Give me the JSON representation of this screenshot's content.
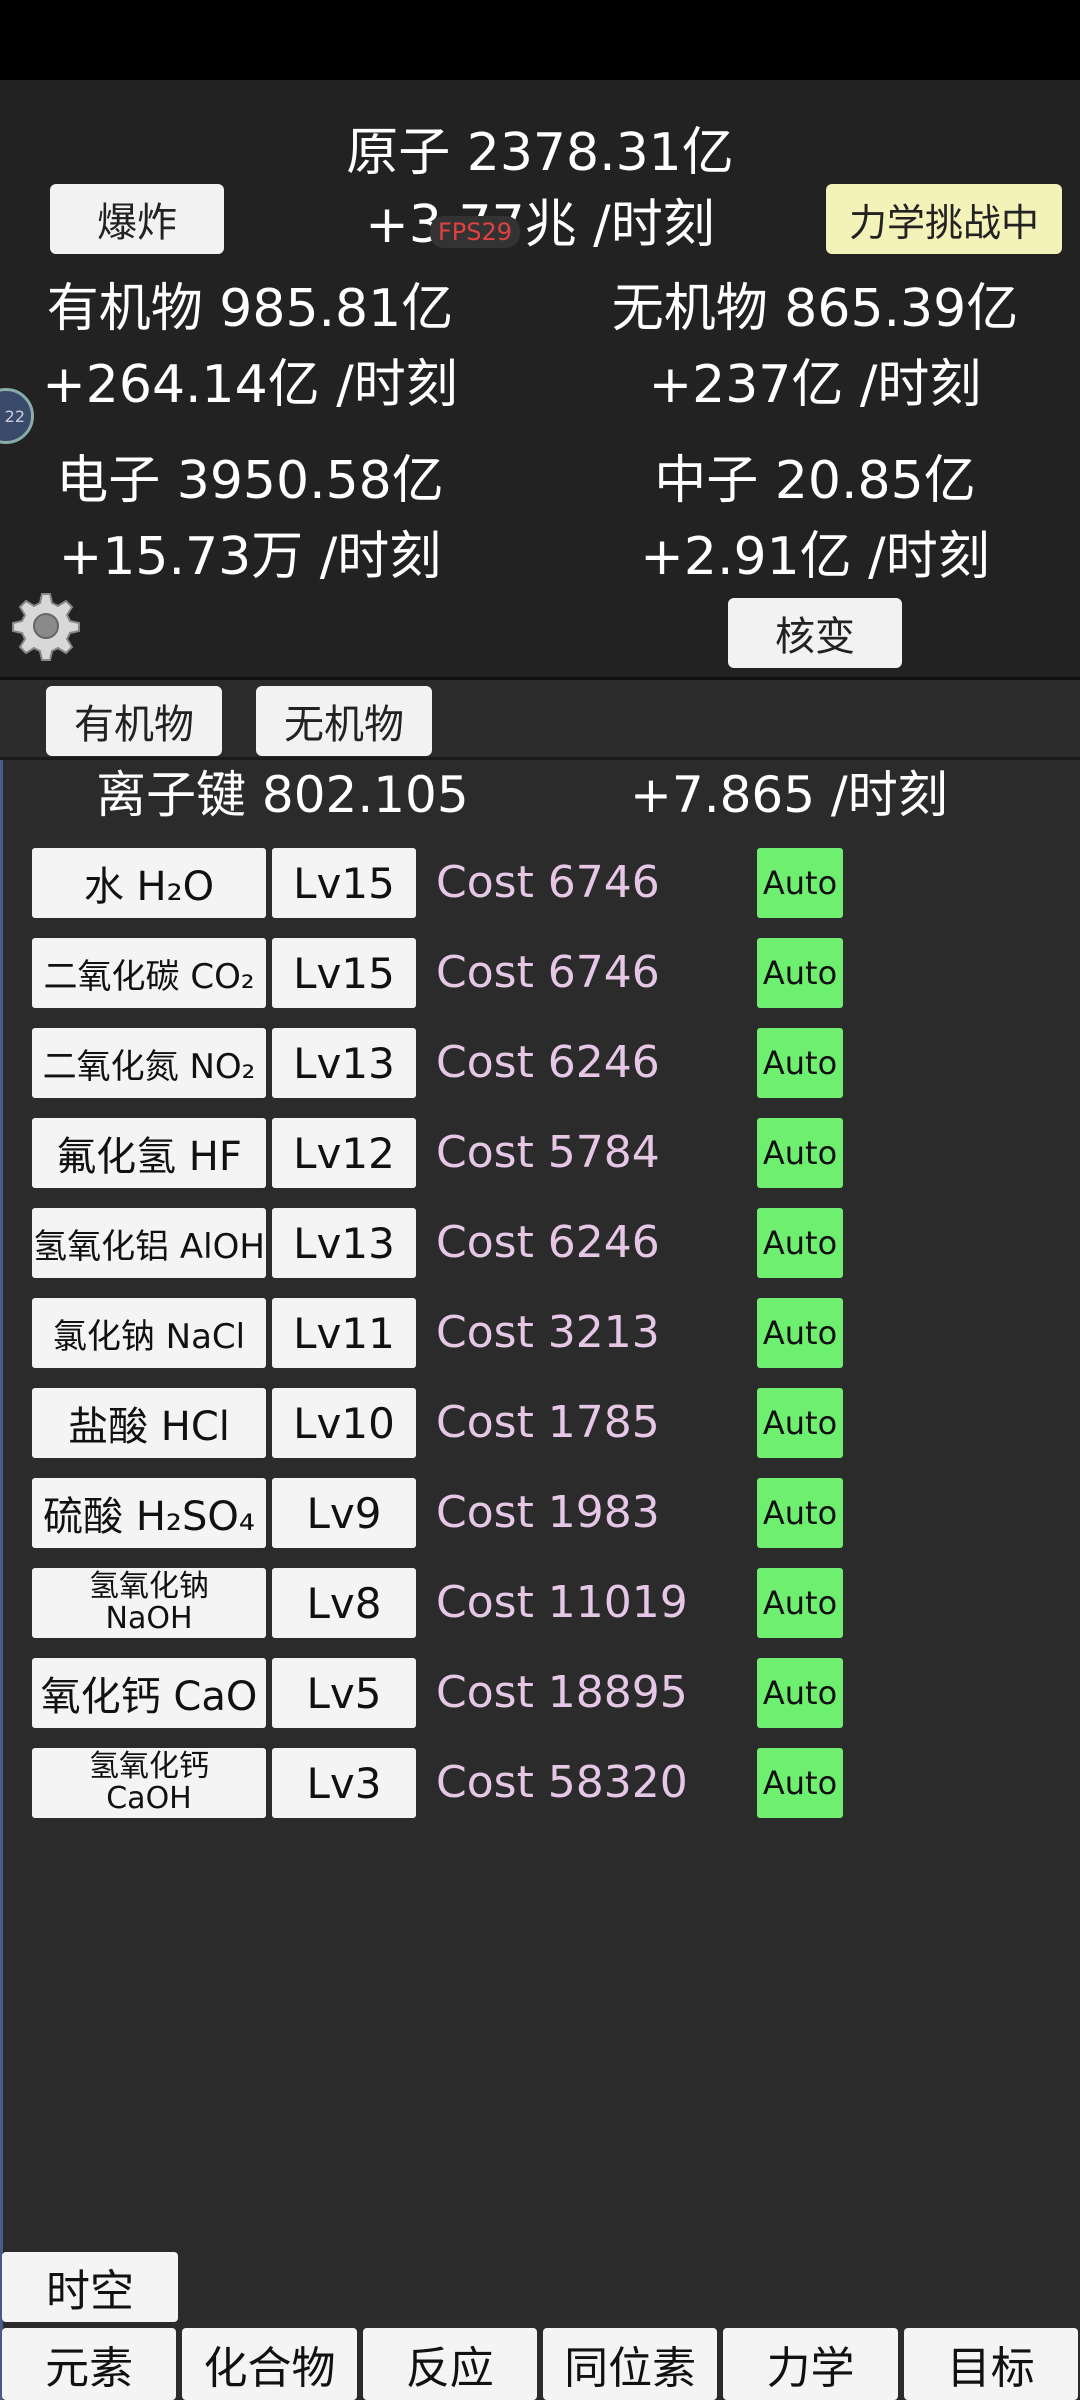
{
  "header": {
    "atom_label": "原子 2378.31亿",
    "atom_rate": "+3.77兆 /时刻",
    "explode_button": "爆炸",
    "challenge_button": "力学挑战中",
    "fps": "FPS29",
    "side_badge": "22",
    "organic_label": "有机物 985.81亿",
    "organic_rate": "+264.14亿 /时刻",
    "inorganic_label": "无机物 865.39亿",
    "inorganic_rate": "+237亿 /时刻",
    "electron_label": "电子 3950.58亿",
    "electron_rate": "+15.73万 /时刻",
    "neutron_label": "中子 20.85亿",
    "neutron_rate": "+2.91亿 /时刻",
    "fission_button": "核变",
    "settings_icon": "gear-icon"
  },
  "categories": [
    {
      "label": "有机物"
    },
    {
      "label": "无机物"
    }
  ],
  "bond": {
    "label": "离子键 802.105",
    "rate": "+7.865 /时刻"
  },
  "compounds": [
    {
      "name": "水 H₂O",
      "level": "Lv15",
      "cost": "Cost 6746",
      "auto": "Auto"
    },
    {
      "name": "二氧化碳 CO₂",
      "level": "Lv15",
      "cost": "Cost 6746",
      "auto": "Auto"
    },
    {
      "name": "二氧化氮 NO₂",
      "level": "Lv13",
      "cost": "Cost 6246",
      "auto": "Auto"
    },
    {
      "name": "氟化氢 HF",
      "level": "Lv12",
      "cost": "Cost 5784",
      "auto": "Auto"
    },
    {
      "name": "氢氧化铝 AlOH",
      "level": "Lv13",
      "cost": "Cost 6246",
      "auto": "Auto"
    },
    {
      "name": "氯化钠 NaCl",
      "level": "Lv11",
      "cost": "Cost 3213",
      "auto": "Auto"
    },
    {
      "name": "盐酸 HCl",
      "level": "Lv10",
      "cost": "Cost 1785",
      "auto": "Auto"
    },
    {
      "name": "硫酸 H₂SO₄",
      "level": "Lv9",
      "cost": "Cost 1983",
      "auto": "Auto"
    },
    {
      "name": "氢氧化钠",
      "name2": "NaOH",
      "level": "Lv8",
      "cost": "Cost 11019",
      "auto": "Auto"
    },
    {
      "name": "氧化钙 CaO",
      "level": "Lv5",
      "cost": "Cost 18895",
      "auto": "Auto"
    },
    {
      "name": "氢氧化钙",
      "name2": "CaOH",
      "level": "Lv3",
      "cost": "Cost 58320",
      "auto": "Auto"
    }
  ],
  "spacetime_button": "时空",
  "tabs": [
    {
      "label": "元素"
    },
    {
      "label": "化合物"
    },
    {
      "label": "反应"
    },
    {
      "label": "同位素"
    },
    {
      "label": "力学"
    },
    {
      "label": "目标"
    }
  ]
}
